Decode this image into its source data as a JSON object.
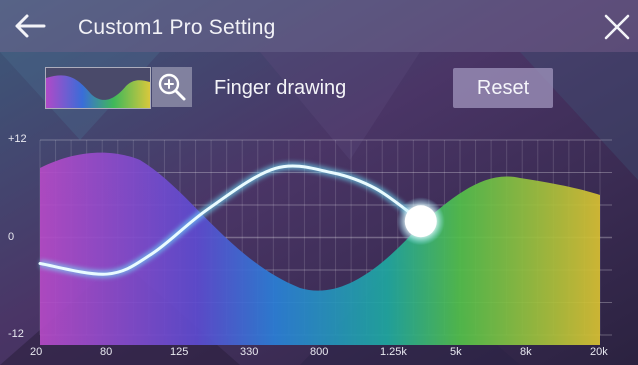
{
  "header": {
    "title": "Custom1 Pro Setting"
  },
  "toolbar": {
    "finger_drawing_label": "Finger drawing",
    "reset_label": "Reset"
  },
  "chart_data": {
    "type": "line",
    "y_ticks": [
      "+12",
      "0",
      "-12"
    ],
    "x_ticks": [
      "20",
      "80",
      "125",
      "330",
      "800",
      "1.25k",
      "5k",
      "8k",
      "20k"
    ],
    "ylim": [
      -12,
      12
    ],
    "series": [
      {
        "points": [
          {
            "x": 0.0,
            "y": -3.2
          },
          {
            "x": 0.12,
            "y": -4.5
          },
          {
            "x": 0.2,
            "y": -2.0
          },
          {
            "x": 0.3,
            "y": 3.5
          },
          {
            "x": 0.42,
            "y": 8.5
          },
          {
            "x": 0.52,
            "y": 8.0
          },
          {
            "x": 0.6,
            "y": 6.0
          },
          {
            "x": 0.68,
            "y": 2.0
          }
        ]
      }
    ],
    "handle": {
      "x": 0.68,
      "y": 2.0
    },
    "grid": true
  }
}
